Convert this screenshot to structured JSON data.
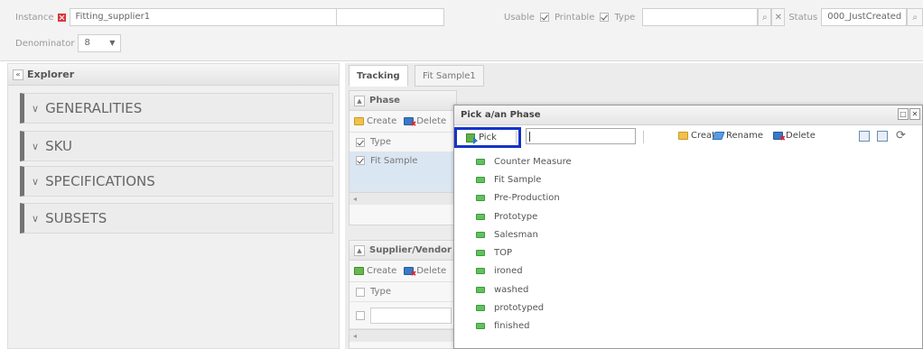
{
  "topbar": {
    "instance_label": "Instance",
    "instance_value": "Fitting_supplier1",
    "usable_label": "Usable",
    "printable_label": "Printable",
    "type_label": "Type",
    "type_value": "",
    "status_label": "Status",
    "status_value": "000_JustCreated",
    "denominator_label": "Denominator",
    "denominator_value": "8"
  },
  "explorer": {
    "title": "Explorer",
    "sections": [
      "GENERALITIES",
      "SKU",
      "SPECIFICATIONS",
      "SUBSETS"
    ]
  },
  "tabs": [
    "Tracking",
    "Fit Sample1"
  ],
  "phase_panel": {
    "title": "Phase",
    "create": "Create",
    "delete": "Delete",
    "col_type": "Type",
    "row_value": "Fit Sample"
  },
  "supplier_panel": {
    "title": "Supplier/Vendor",
    "create": "Create",
    "delete": "Delete",
    "col_type": "Type"
  },
  "dialog": {
    "title": "Pick a/an Phase",
    "pick": "Pick",
    "search_value": "",
    "create": "Create",
    "rename": "Rename",
    "delete": "Delete",
    "items": [
      "Counter Measure",
      "Fit Sample",
      "Pre-Production",
      "Prototype",
      "Salesman",
      "TOP",
      "ironed",
      "washed",
      "prototyped",
      "finished"
    ]
  },
  "colors": {
    "highlight": "#1433c8",
    "leaf": "#62c15e",
    "accent_bar": "#737373"
  }
}
